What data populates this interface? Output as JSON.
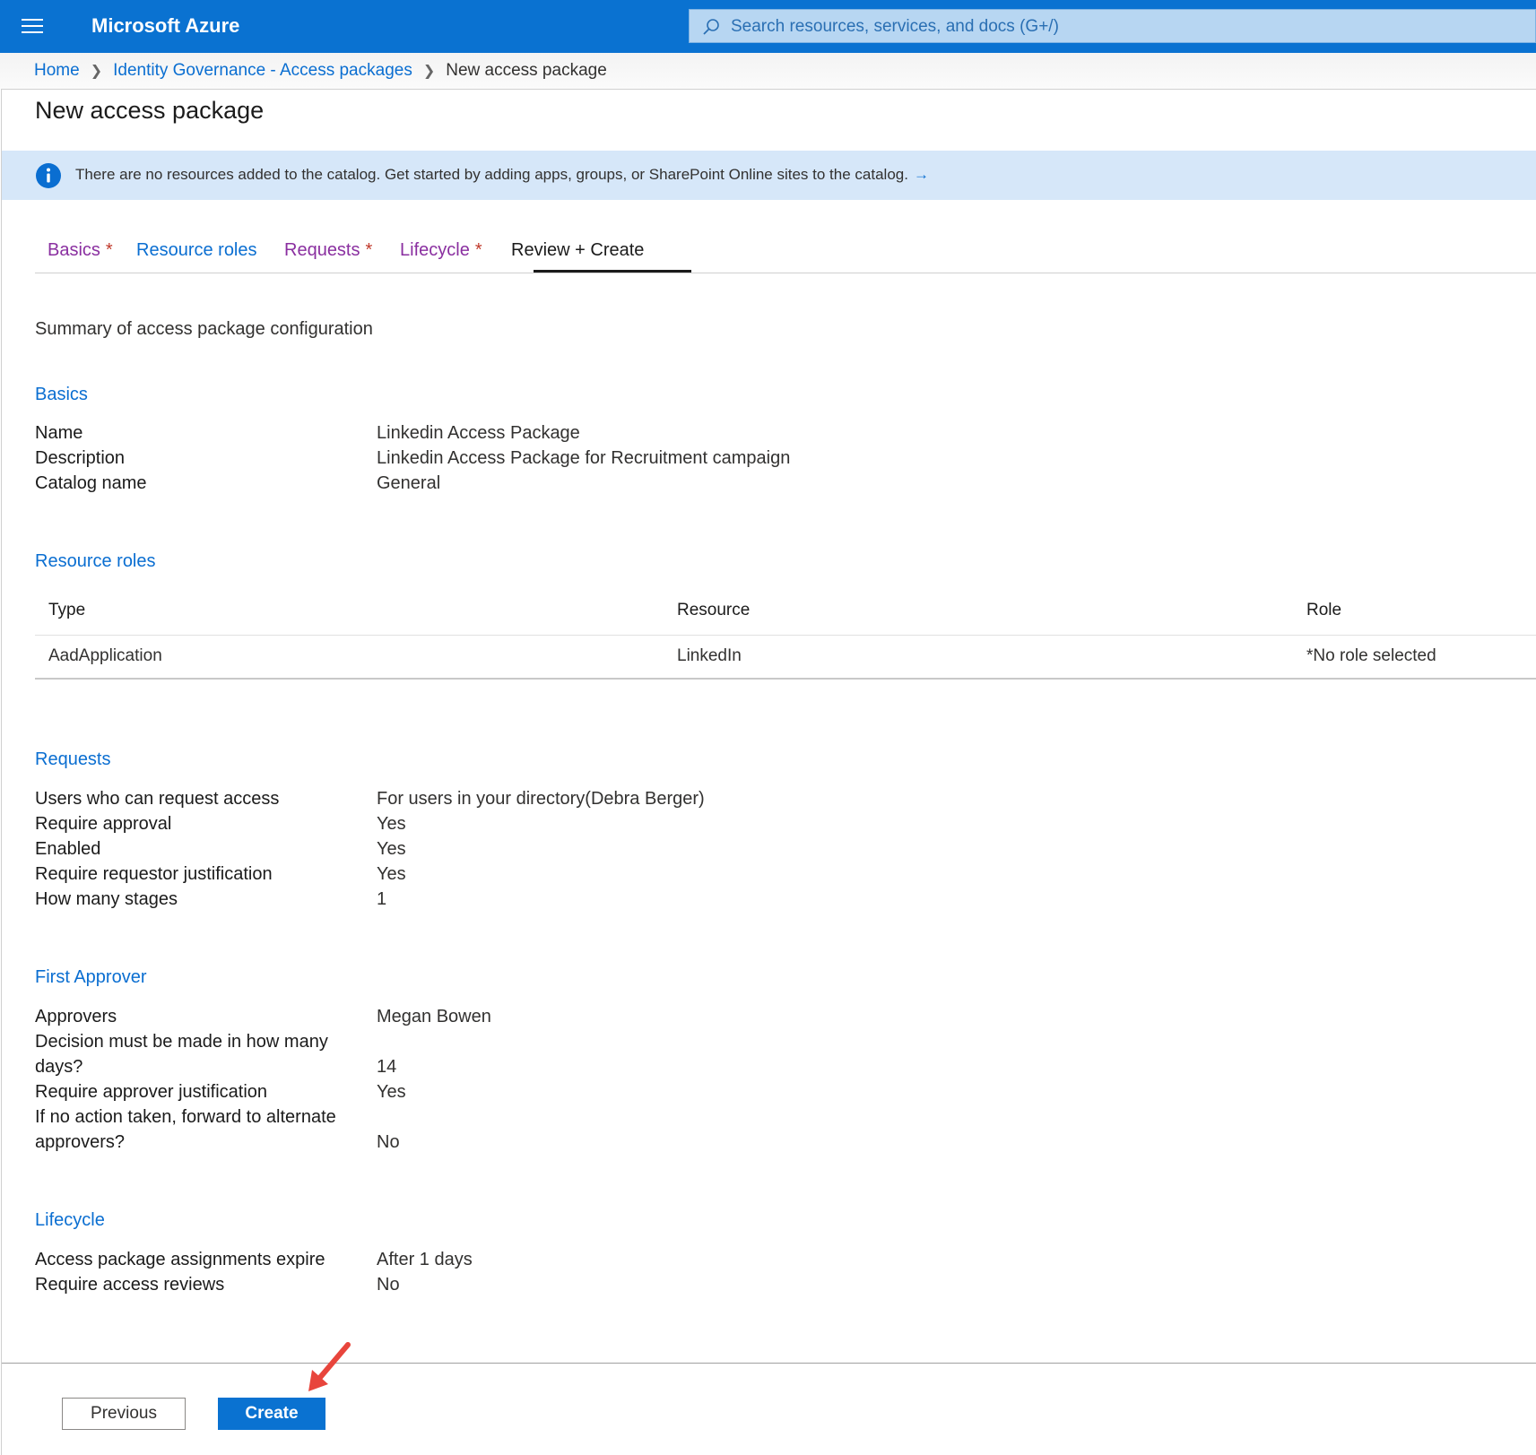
{
  "header": {
    "brand": "Microsoft Azure",
    "search_placeholder": "Search resources, services, and docs (G+/)"
  },
  "breadcrumb": {
    "home": "Home",
    "parent": "Identity Governance - Access packages",
    "current": "New access package"
  },
  "page": {
    "title": "New access package",
    "info_message": "There are no resources added to the catalog. Get started by adding apps, groups, or SharePoint Online sites to the catalog.",
    "info_arrow": "→"
  },
  "tabs": [
    {
      "label": "Basics",
      "required": "*"
    },
    {
      "label": "Resource roles",
      "required": ""
    },
    {
      "label": "Requests",
      "required": "*"
    },
    {
      "label": "Lifecycle",
      "required": "*"
    },
    {
      "label": "Review + Create",
      "required": ""
    }
  ],
  "summary_heading": "Summary of access package configuration",
  "basics": {
    "heading": "Basics",
    "name_label": "Name",
    "name_value": "Linkedin Access Package",
    "description_label": "Description",
    "description_value": "Linkedin Access Package for Recruitment campaign",
    "catalog_label": "Catalog name",
    "catalog_value": "General"
  },
  "resource_roles": {
    "heading": "Resource roles",
    "columns": [
      "Type",
      "Resource",
      "Role"
    ],
    "rows": [
      [
        "AadApplication",
        "LinkedIn",
        "*No role selected"
      ]
    ]
  },
  "requests": {
    "heading": "Requests",
    "items": [
      {
        "label": "Users who can request access",
        "value": "For users in your directory(Debra Berger)"
      },
      {
        "label": "Require approval",
        "value": "Yes"
      },
      {
        "label": "Enabled",
        "value": "Yes"
      },
      {
        "label": "Require requestor justification",
        "value": "Yes"
      },
      {
        "label": "How many stages",
        "value": "1"
      }
    ]
  },
  "first_approver": {
    "heading": "First Approver",
    "approvers_label": "Approvers",
    "approvers_value": "Megan Bowen",
    "decision_label_line1": "Decision must be made in how many",
    "decision_label_line2": "days?",
    "decision_value": "14",
    "justification_label": "Require approver justification",
    "justification_value": "Yes",
    "forward_label_line1": "If no action taken, forward to alternate",
    "forward_label_line2": "approvers?",
    "forward_value": "No"
  },
  "lifecycle": {
    "heading": "Lifecycle",
    "expire_label": "Access package assignments expire",
    "expire_value": "After 1 days",
    "reviews_label": "Require access reviews",
    "reviews_value": "No"
  },
  "footer": {
    "previous_label": "Previous",
    "create_label": "Create"
  },
  "colors": {
    "brand_blue": "#0a72d1",
    "link_blue": "#0a6ed1",
    "visited_purple": "#8a2fa0",
    "info_bg": "#d6e7f9",
    "annotation_red": "#e8453c"
  }
}
